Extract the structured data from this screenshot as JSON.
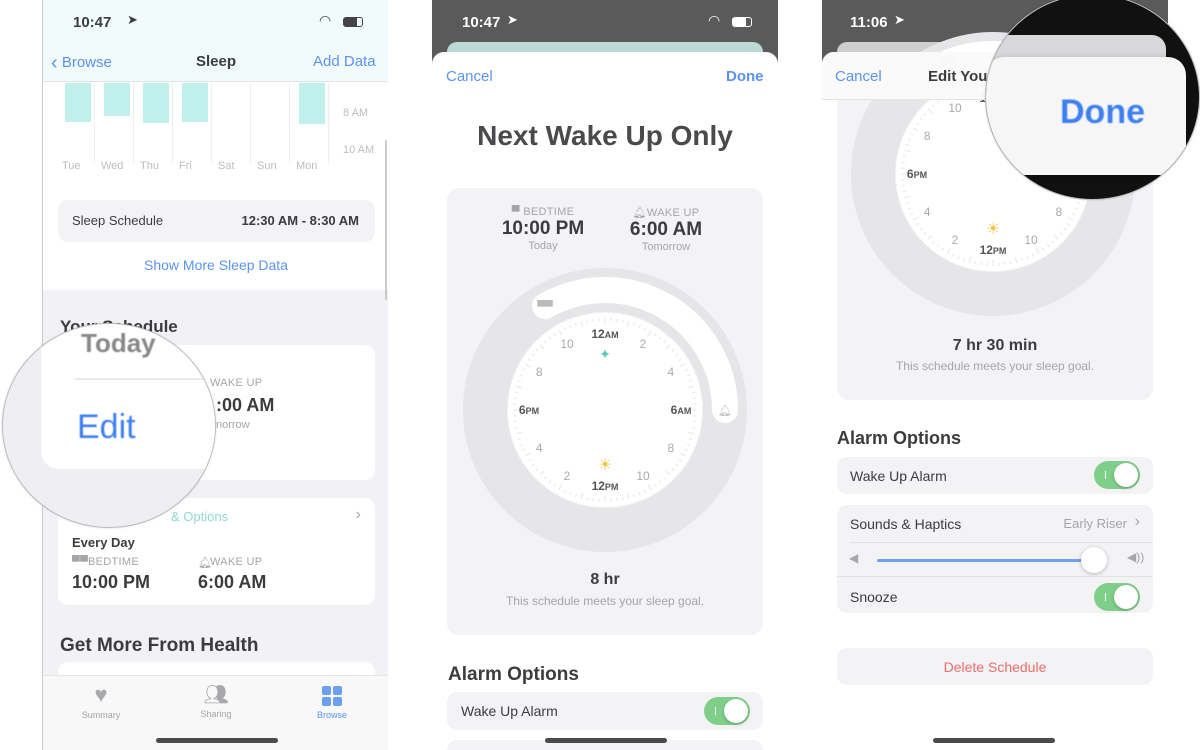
{
  "colors": {
    "accent": "#5b93ee",
    "teal": "#bff0ec",
    "toggle_on": "#7fcf8a",
    "destructive": "#ea6e6a"
  },
  "screen1": {
    "status_time": "10:47",
    "nav": {
      "back": "Browse",
      "title": "Sleep",
      "action": "Add Data"
    },
    "chart": {
      "days": [
        "Tue",
        "Wed",
        "Thu",
        "Fri",
        "Sat",
        "Sun",
        "Mon"
      ],
      "y_labels": [
        "8 AM",
        "10 AM"
      ]
    },
    "sleep_schedule": {
      "label": "Sleep Schedule",
      "value": "12:30 AM - 8:30 AM"
    },
    "show_more": "Show More Sleep Data",
    "your_schedule": {
      "title": "Your Schedule",
      "today": "Today",
      "wake_label": "WAKE UP",
      "wake_time_partial": ":00 AM",
      "tomorrow_partial": "norrow",
      "edit": "Edit"
    },
    "options_card": {
      "link_partial": "& Options",
      "repeat": "Every Day",
      "bed_label": "BEDTIME",
      "bed_time": "10:00 PM",
      "wake_label": "WAKE UP",
      "wake_time": "6:00 AM"
    },
    "get_more": "Get More From Health",
    "tabs": [
      {
        "label": "Summary",
        "icon": "heart-icon"
      },
      {
        "label": "Sharing",
        "icon": "people-icon"
      },
      {
        "label": "Browse",
        "icon": "grid-icon",
        "active": true
      }
    ]
  },
  "screen2": {
    "status_time": "10:47",
    "cancel": "Cancel",
    "done": "Done",
    "title": "Next Wake Up Only",
    "bedtime": {
      "label": "BEDTIME",
      "time": "10:00 PM",
      "day": "Today"
    },
    "wakeup": {
      "label": "WAKE UP",
      "time": "6:00 AM",
      "day": "Tomorrow"
    },
    "duration": "8 hr",
    "goal_note": "This schedule meets your sleep goal.",
    "alarm_title": "Alarm Options",
    "wake_alarm": {
      "label": "Wake Up Alarm",
      "on": true
    }
  },
  "screen3": {
    "status_time": "11:06",
    "cancel": "Cancel",
    "title_partial": "Edit Your",
    "done": "Done",
    "duration": "7 hr 30 min",
    "goal_note": "This schedule meets your sleep goal.",
    "alarm_title": "Alarm Options",
    "wake_alarm": {
      "label": "Wake Up Alarm",
      "on": true
    },
    "sounds": {
      "label": "Sounds & Haptics",
      "value": "Early Riser"
    },
    "volume": 0.95,
    "snooze": {
      "label": "Snooze",
      "on": true
    },
    "delete": "Delete Schedule"
  },
  "clock_labels": [
    {
      "num": "12",
      "suffix": "AM",
      "hour": 0
    },
    {
      "num": "2",
      "hour": 2
    },
    {
      "num": "4",
      "hour": 4
    },
    {
      "num": "6",
      "suffix": "AM",
      "hour": 6
    },
    {
      "num": "8",
      "hour": 8
    },
    {
      "num": "10",
      "hour": 10
    },
    {
      "num": "12",
      "suffix": "PM",
      "hour": 12
    },
    {
      "num": "2",
      "hour": 14
    },
    {
      "num": "4",
      "hour": 16
    },
    {
      "num": "6",
      "suffix": "PM",
      "hour": 18
    },
    {
      "num": "8",
      "hour": 20
    },
    {
      "num": "10",
      "hour": 22
    }
  ],
  "clock2": {
    "bed_hour": 22,
    "wake_hour": 6
  },
  "clock3": {
    "bed_hour": 22.5,
    "wake_hour": 6
  }
}
